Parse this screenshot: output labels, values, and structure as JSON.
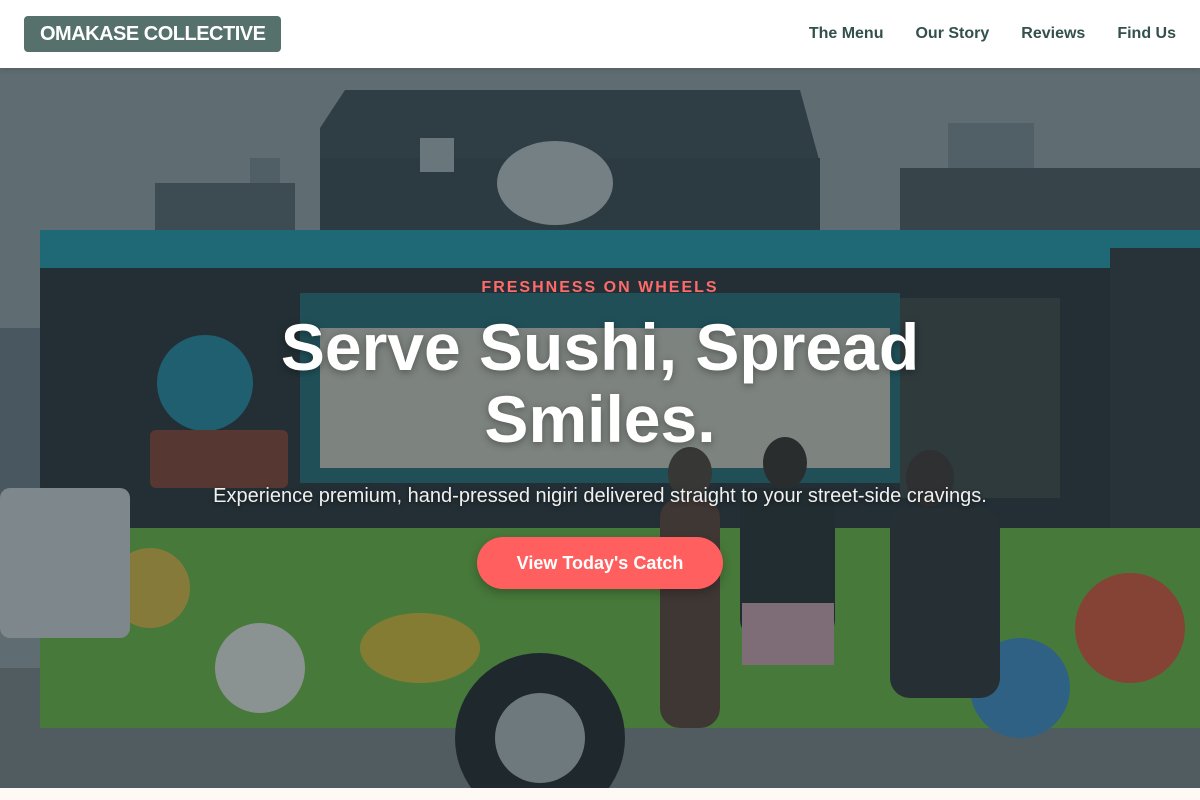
{
  "navbar": {
    "logo": "OMAKASE COLLECTIVE",
    "links": [
      "The Menu",
      "Our Story",
      "Reviews",
      "Find Us"
    ]
  },
  "hero": {
    "eyebrow": "FRESHNESS ON WHEELS",
    "headline": "Serve Sushi, Spread Smiles.",
    "subtitle": "Experience premium, hand-pressed nigiri delivered straight to your street-side cravings.",
    "cta_label": "View Today's Catch"
  },
  "colors": {
    "accent": "#ff5f5f",
    "logo_bg": "#56706c",
    "nav_text": "#33504c"
  }
}
